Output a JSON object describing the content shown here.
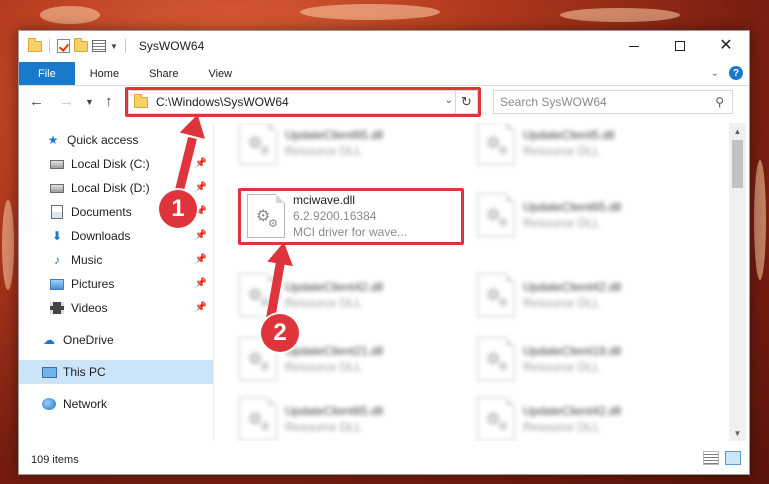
{
  "window": {
    "title": "SysWOW64",
    "controls": {
      "minimize_icon": "minimize-icon",
      "maximize_icon": "maximize-icon",
      "close_icon": "close-icon"
    }
  },
  "ribbon": {
    "tabs": [
      {
        "label": "File",
        "active": true
      },
      {
        "label": "Home"
      },
      {
        "label": "Share"
      },
      {
        "label": "View"
      }
    ],
    "help_label": "?"
  },
  "address": {
    "path": "C:\\Windows\\SysWOW64",
    "search_placeholder": "Search SysWOW64"
  },
  "sidebar": {
    "items": [
      {
        "label": "Quick access",
        "icon": "star-icon"
      },
      {
        "label": "Local Disk (C:)",
        "icon": "drive-icon",
        "pinned": true
      },
      {
        "label": "Local Disk (D:)",
        "icon": "drive-icon",
        "pinned": true
      },
      {
        "label": "Documents",
        "icon": "documents-icon",
        "pinned": true
      },
      {
        "label": "Downloads",
        "icon": "downloads-icon",
        "pinned": true
      },
      {
        "label": "Music",
        "icon": "music-icon",
        "pinned": true
      },
      {
        "label": "Pictures",
        "icon": "pictures-icon",
        "pinned": true
      },
      {
        "label": "Videos",
        "icon": "videos-icon",
        "pinned": true
      },
      {
        "label": "OneDrive",
        "icon": "cloud-icon"
      },
      {
        "label": "This PC",
        "icon": "computer-icon",
        "selected": true
      },
      {
        "label": "Network",
        "icon": "network-icon"
      }
    ]
  },
  "files": {
    "items": [
      {
        "name": "UpdateClient65.dll",
        "type": "Resource DLL"
      },
      {
        "name": "UpdateClient5.dll",
        "type": "Resource DLL"
      },
      {
        "name": "mciwave.dll",
        "version": "6.2.9200.16384",
        "description": "MCI driver for wave...",
        "highlighted": true
      },
      {
        "name": "UpdateClient65.dll",
        "type": "Resource DLL"
      },
      {
        "name": "UpdateClient42.dll",
        "type": "Resource DLL"
      },
      {
        "name": "UpdateClient42.dll",
        "type": "Resource DLL"
      },
      {
        "name": "UpdateClient21.dll",
        "type": "Resource DLL"
      },
      {
        "name": "UpdateClient19.dll",
        "type": "Resource DLL"
      },
      {
        "name": "UpdateClient65.dll",
        "type": "Resource DLL"
      },
      {
        "name": "UpdateClient42.dll",
        "type": "Resource DLL"
      }
    ]
  },
  "status": {
    "item_count": "109 items"
  },
  "annotations": {
    "marker1": "1",
    "marker2": "2",
    "accent_color": "#e0343c"
  }
}
